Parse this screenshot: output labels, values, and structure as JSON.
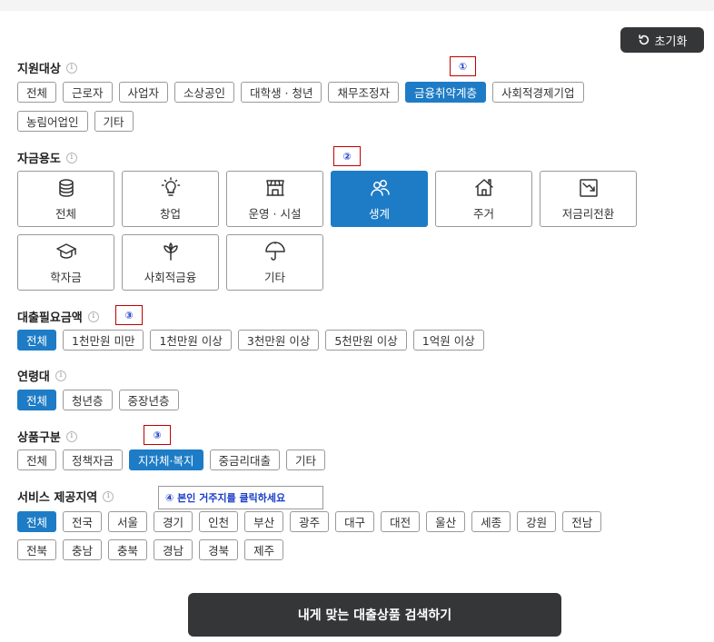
{
  "reset": {
    "label": "초기화"
  },
  "sections": {
    "target": {
      "title": "지원대상",
      "row1": [
        "전체",
        "근로자",
        "사업자",
        "소상공인",
        "대학생 · 청년",
        "채무조정자",
        "금융취약계층",
        "사회적경제기업"
      ],
      "row2": [
        "농림어업인",
        "기타"
      ],
      "active": "금융취약계층"
    },
    "purpose": {
      "title": "자금용도",
      "row1": [
        "전체",
        "창업",
        "운영 · 시설",
        "생계",
        "주거",
        "저금리전환"
      ],
      "row2": [
        "학자금",
        "사회적금융",
        "기타"
      ],
      "active": "생계"
    },
    "amount": {
      "title": "대출필요금액",
      "items": [
        "전체",
        "1천만원 미만",
        "1천만원 이상",
        "3천만원 이상",
        "5천만원 이상",
        "1억원 이상"
      ],
      "active": "전체"
    },
    "age": {
      "title": "연령대",
      "items": [
        "전체",
        "청년층",
        "중장년층"
      ],
      "active": "전체"
    },
    "product": {
      "title": "상품구분",
      "items": [
        "전체",
        "정책자금",
        "지자체·복지",
        "중금리대출",
        "기타"
      ],
      "active": "지자체·복지"
    },
    "region": {
      "title": "서비스 제공지역",
      "row1": [
        "전체",
        "전국",
        "서울",
        "경기",
        "인천",
        "부산",
        "광주",
        "대구",
        "대전",
        "울산",
        "세종",
        "강원",
        "전남"
      ],
      "row2": [
        "전북",
        "충남",
        "충북",
        "경남",
        "경북",
        "제주"
      ],
      "active": "전체"
    }
  },
  "annotations": {
    "m1": "①",
    "m2": "②",
    "m3a": "③",
    "m3b": "③",
    "note4": "④ 본인 거주지를 클릭하세요"
  },
  "search": {
    "label": "내게 맞는 대출상품 검색하기"
  },
  "colors": {
    "accent": "#1e7cc6",
    "dark_button": "#353638",
    "marker_border": "#c00000",
    "marker_text": "#1a3cc8"
  }
}
